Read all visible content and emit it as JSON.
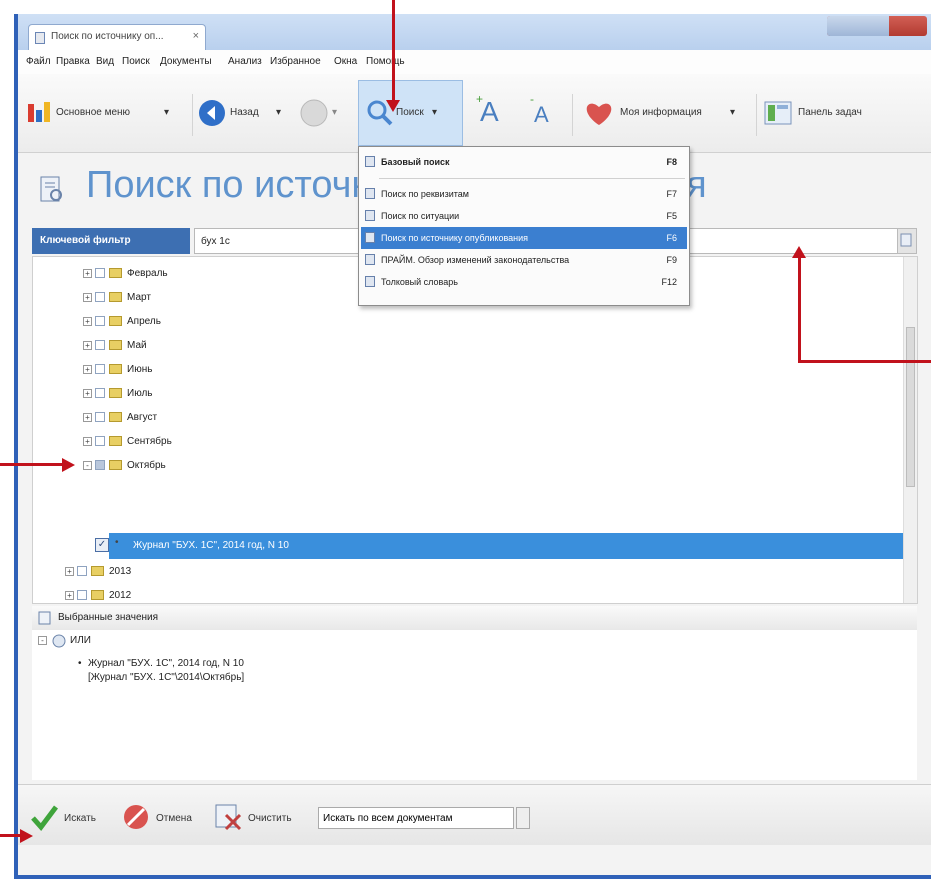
{
  "window": {
    "tab_title": "Поиск по источнику оп...",
    "tab_close": "×"
  },
  "menu": [
    "Файл",
    "Правка",
    "Вид",
    "Поиск",
    "Документы",
    "Анализ",
    "Избранное",
    "Окна",
    "Помощь"
  ],
  "toolbar": {
    "main_menu": "Основное меню",
    "back": "Назад",
    "search": "Поиск",
    "font_increase": "A",
    "font_decrease": "A",
    "my_info": "Моя информация",
    "tasks": "Панель задач"
  },
  "page": {
    "title": "Поиск по источнику опубликования"
  },
  "search_menu": {
    "items": [
      {
        "label": "Базовый поиск",
        "key": "F8",
        "icon": "search-icon"
      },
      {
        "label": "Поиск по реквизитам",
        "key": "F7",
        "icon": "doc-search-icon"
      },
      {
        "label": "Поиск по ситуации",
        "key": "F5",
        "icon": "situation-icon"
      },
      {
        "label": "Поиск по источнику опубликования",
        "key": "F6",
        "icon": "source-icon"
      },
      {
        "label": "ПРАЙМ. Обзор изменений законодательства",
        "key": "F9",
        "icon": "prime-icon"
      },
      {
        "label": "Толковый словарь",
        "key": "F12",
        "icon": "dictionary-icon"
      }
    ],
    "selected_index": 3
  },
  "filter": {
    "label": "Ключевой фильтр",
    "value": "бух 1с"
  },
  "tree": {
    "months": [
      "Февраль",
      "Март",
      "Апрель",
      "Май",
      "Июнь",
      "Июль",
      "Август",
      "Сентябрь",
      "Октябрь"
    ],
    "selected_item": "Журнал \"БУХ. 1С\", 2014 год, N 10",
    "years": [
      "2013",
      "2012"
    ]
  },
  "results": {
    "header": "Выбранные значения",
    "root": "ИЛИ",
    "item_line1": "Журнал \"БУХ. 1С\", 2014 год, N 10",
    "item_line2": "[Журнал \"БУХ. 1С\"\\2014\\Октябрь]"
  },
  "bottom": {
    "find": "Искать",
    "cancel": "Отмена",
    "clear": "Очистить",
    "scope": "Искать по всем документам"
  },
  "colors": {
    "accent": "#3d6fb2",
    "selection": "#3a8fdc",
    "annotation_arrow": "#c1121c",
    "title": "#5f93cd"
  }
}
